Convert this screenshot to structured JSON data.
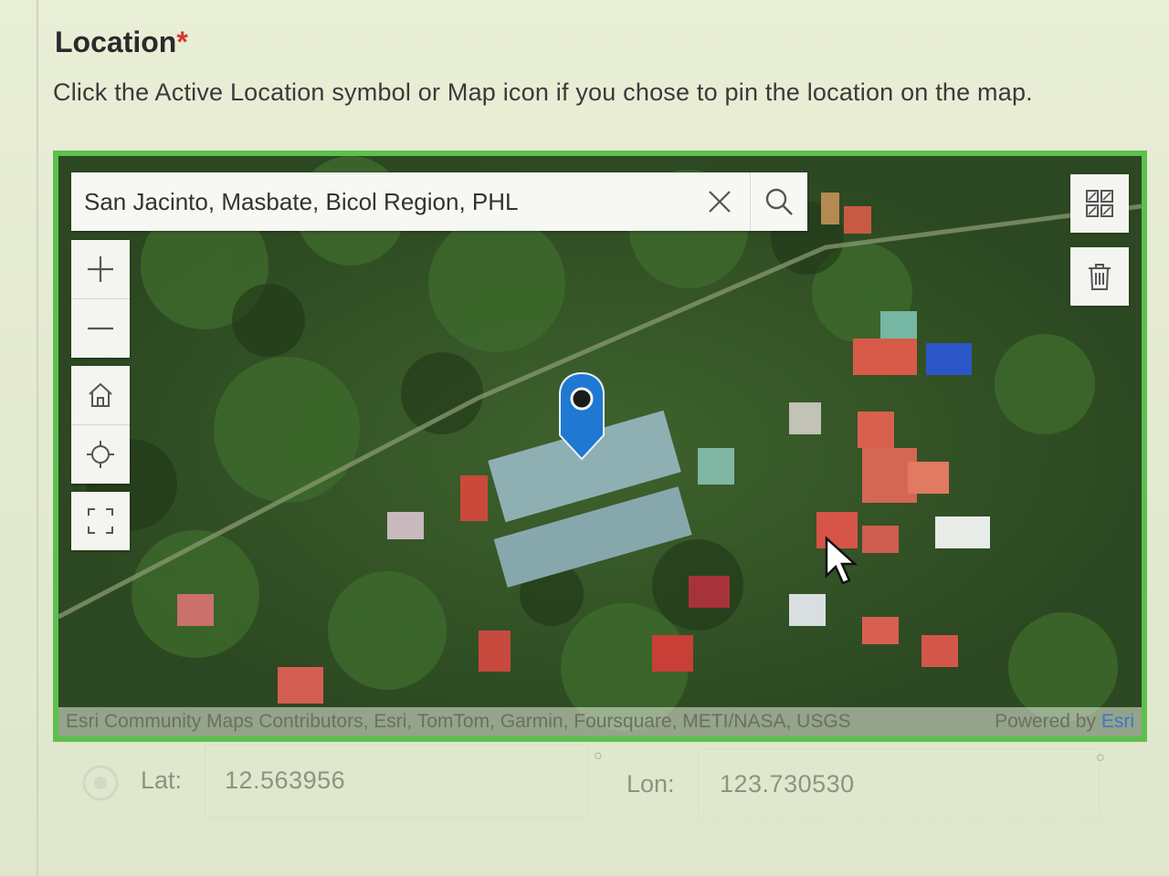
{
  "field": {
    "title": "Location",
    "required_mark": "*",
    "help_text": "Click the Active Location symbol or Map icon if you chose to pin the location on the map."
  },
  "map": {
    "search": {
      "value": "San Jacinto, Masbate, Bicol Region, PHL"
    },
    "attribution": {
      "sources": "Esri Community Maps Contributors, Esri, TomTom, Garmin, Foursquare, METI/NASA, USGS",
      "powered_by": "Powered by ",
      "powered_by_link": "Esri"
    },
    "icons": {
      "clear": "close-icon",
      "search": "search-icon",
      "zoom_in": "plus-icon",
      "zoom_out": "minus-icon",
      "home": "home-icon",
      "locate": "crosshair-icon",
      "fullscreen": "fullscreen-icon",
      "basemap": "basemap-gallery-icon",
      "delete": "trash-icon",
      "pin": "map-pin-icon"
    },
    "colors": {
      "frame": "#5cc04f",
      "pin": "#1f78d1"
    }
  },
  "coordinates": {
    "lat_label": "Lat:",
    "lat_value": "12.563956",
    "lon_label": "Lon:",
    "lon_value": "123.730530"
  }
}
